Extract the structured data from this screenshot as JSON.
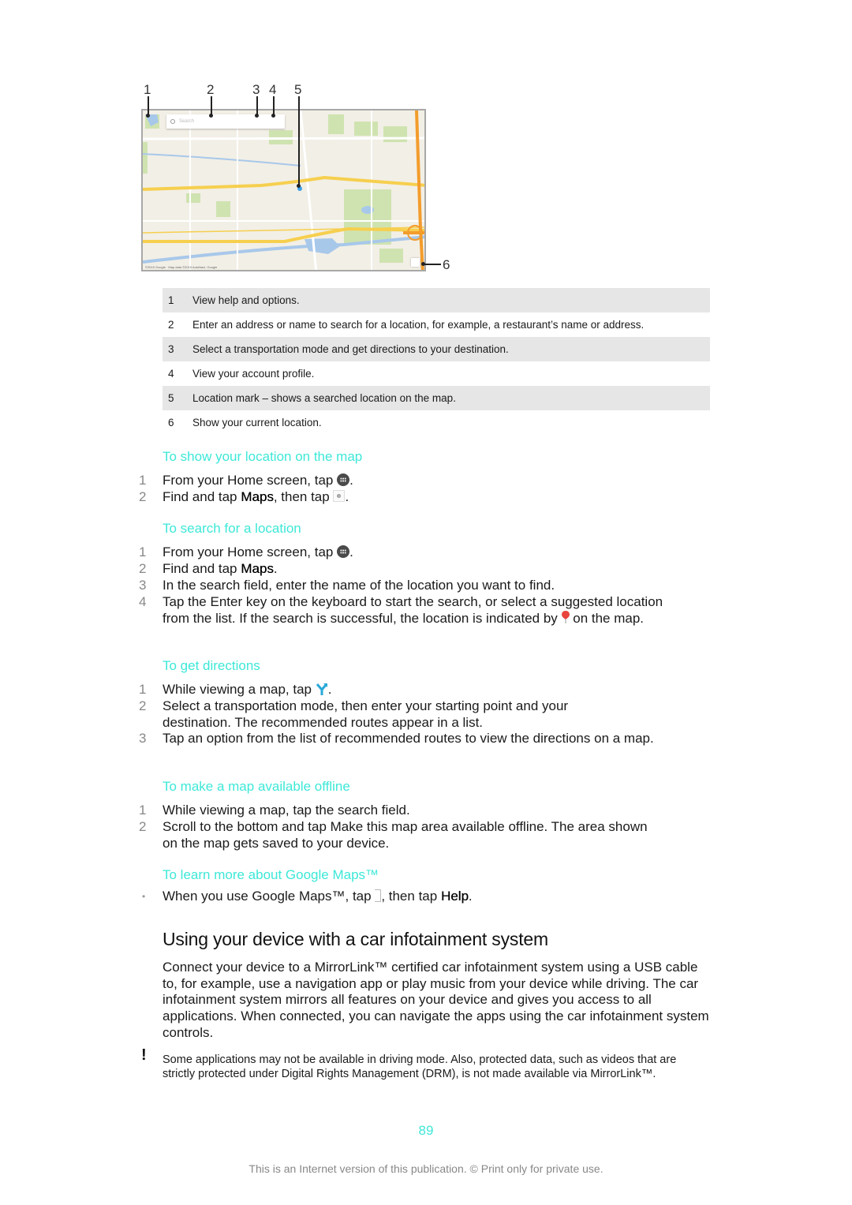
{
  "figure": {
    "callouts": [
      "1",
      "2",
      "3",
      "4",
      "5",
      "6"
    ],
    "map": {
      "search_placeholder": "Search",
      "copyright": "©2015 Google · Map data ©2015 AutoNavi, Google",
      "colors": {
        "land": "#f2efe6",
        "park": "#cfe3b0",
        "water": "#a8c8ea",
        "highway": "#f6cf4e",
        "expressway": "#f39c2c",
        "road": "#ffffff"
      }
    }
  },
  "legend": [
    {
      "num": "1",
      "text": "View help and options."
    },
    {
      "num": "2",
      "text": "Enter an address or name to search for a location, for example, a restaurant’s name or address."
    },
    {
      "num": "3",
      "text": "Select a transportation mode and get directions to your destination."
    },
    {
      "num": "4",
      "text": "View your account profile."
    },
    {
      "num": "5",
      "text": "Location mark – shows a searched location on the map."
    },
    {
      "num": "6",
      "text": "Show your current location."
    }
  ],
  "procedures": {
    "show_location": {
      "heading": "To show your location on the map",
      "steps": [
        {
          "num": "1",
          "pre": "From your Home screen, tap ",
          "icon": "apps-icon",
          "post": "."
        },
        {
          "num": "2",
          "pre": "Find and tap ",
          "bold": "Maps",
          "mid": ", then tap ",
          "icon": "my-location-icon",
          "post": "."
        }
      ]
    },
    "search_location": {
      "heading": "To search for a location",
      "steps": [
        {
          "num": "1",
          "pre": "From your Home screen, tap ",
          "icon": "apps-icon",
          "post": "."
        },
        {
          "num": "2",
          "pre": "Find and tap ",
          "bold": "Maps",
          "post": "."
        },
        {
          "num": "3",
          "text": "In the search field, enter the name of the location you want to find."
        },
        {
          "num": "4",
          "pre": "Tap the Enter key on the keyboard to start the search, or select a suggested location from the list. If the search is successful, the location is indicated by ",
          "icon": "map-pin-icon",
          "post": " on the map."
        }
      ]
    },
    "get_directions": {
      "heading": "To get directions",
      "steps": [
        {
          "num": "1",
          "pre": "While viewing a map, tap ",
          "icon": "directions-icon",
          "post": "."
        },
        {
          "num": "2",
          "text": "Select a transportation mode, then enter your starting point and your destination. The recommended routes appear in a list."
        },
        {
          "num": "3",
          "text": "Tap an option from the list of recommended routes to view the directions on a map."
        }
      ]
    },
    "offline": {
      "heading": "To make a map available offline",
      "steps": [
        {
          "num": "1",
          "text": "While viewing a map, tap the search field."
        },
        {
          "num": "2",
          "text": "Scroll to the bottom and tap Make this map area available offline. The area shown on the map gets saved to your device."
        }
      ]
    },
    "learn_more": {
      "heading": "To learn more about Google Maps™",
      "bullet": "•",
      "pre": "When you use Google Maps™, tap ",
      "icon": "menu-icon",
      "mid": ", then tap ",
      "bold": "Help",
      "post": "."
    }
  },
  "section": {
    "heading": "Using your device with a car infotainment system",
    "paragraph": "Connect your device to a MirrorLink™ certified car infotainment system using a USB cable to, for example, use a navigation app or play music from your device while driving. The car infotainment system mirrors all features on your device and gives you access to all applications. When connected, you can navigate the apps using the car infotainment system controls.",
    "note_mark": "!",
    "note": "Some applications may not be available in driving mode. Also, protected data, such as videos that are strictly protected under Digital Rights Management (DRM), is not made available via MirrorLink™."
  },
  "page_number": "89",
  "footer": "This is an Internet version of this publication. © Print only for private use.",
  "colors": {
    "heading_accent": "#3de8d8",
    "legend_shade": "#e6e6e6",
    "text": "#1a1a1a"
  }
}
